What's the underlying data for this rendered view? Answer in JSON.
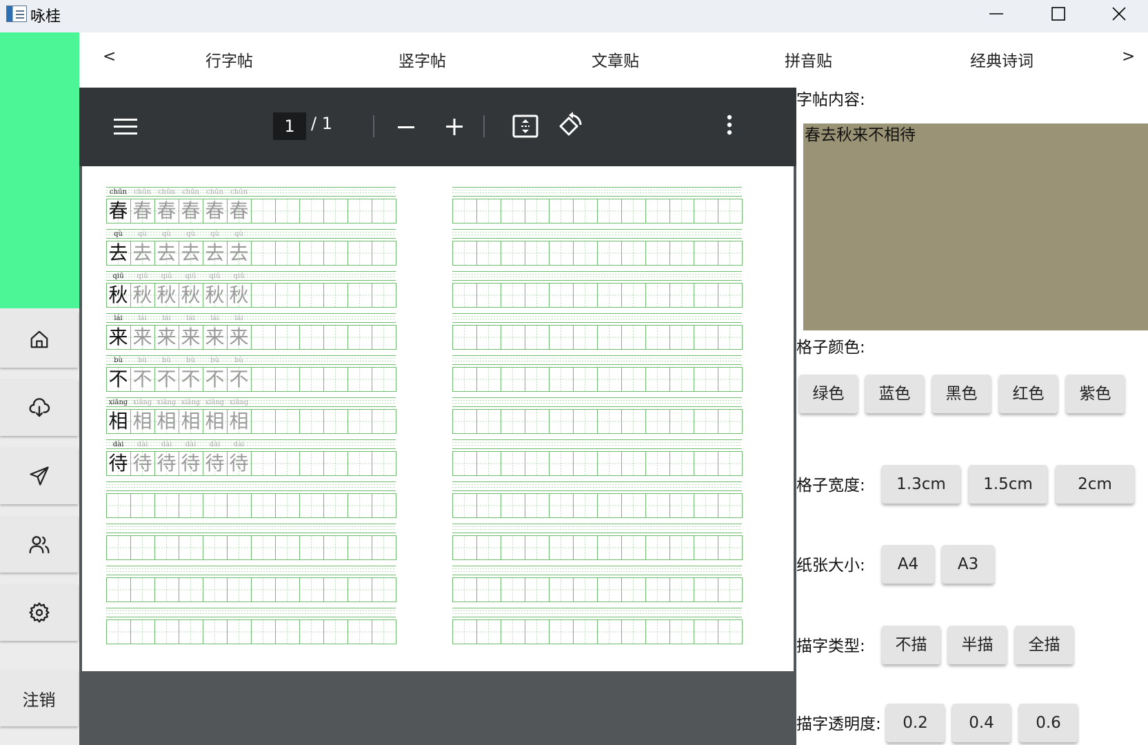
{
  "window": {
    "title": "咏桂",
    "icon": "app-window-icon"
  },
  "tabs": {
    "prev": "<",
    "next": ">",
    "items": [
      "行字帖",
      "竖字帖",
      "文章贴",
      "拼音贴",
      "经典诗词"
    ]
  },
  "sidebar": {
    "icons": [
      "home-icon",
      "download-icon",
      "send-icon",
      "users-icon",
      "settings-icon"
    ],
    "logout": "注销"
  },
  "viewer": {
    "current_page": "1",
    "total_pages": "/  1"
  },
  "worksheet": {
    "rows": [
      {
        "char": "春",
        "pinyin": "chūn"
      },
      {
        "char": "去",
        "pinyin": "qù"
      },
      {
        "char": "秋",
        "pinyin": "qiū"
      },
      {
        "char": "来",
        "pinyin": "lái"
      },
      {
        "char": "不",
        "pinyin": "bù"
      },
      {
        "char": "相",
        "pinyin": "xiāng"
      },
      {
        "char": "待",
        "pinyin": "dài"
      }
    ],
    "grid_color": "#6dbb6d"
  },
  "settings": {
    "content_label": "字帖内容:",
    "content_value": "春去秋来不相待",
    "color_label": "格子颜色:",
    "colors": [
      "绿色",
      "蓝色",
      "黑色",
      "红色",
      "紫色"
    ],
    "width_label": "格子宽度:",
    "widths": [
      "1.3cm",
      "1.5cm",
      "2cm"
    ],
    "paper_label": "纸张大小:",
    "papers": [
      "A4",
      "A3"
    ],
    "trace_label": "描字类型:",
    "traces": [
      "不描",
      "半描",
      "全描"
    ],
    "opacity_label": "描字透明度:",
    "opacities": [
      "0.2",
      "0.4",
      "0.6"
    ]
  },
  "colors": {
    "accent": "#4cf596",
    "content_bg": "#9a9376",
    "toolbar": "#323639"
  }
}
